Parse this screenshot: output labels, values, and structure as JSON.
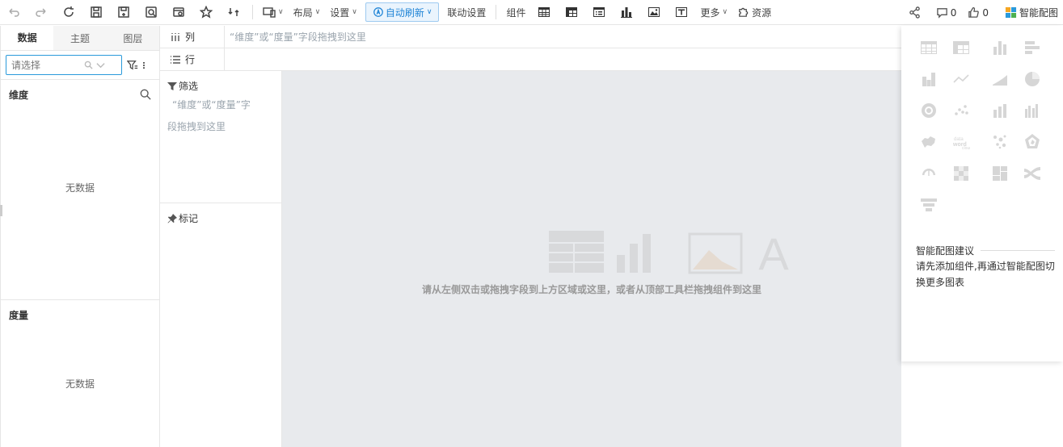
{
  "toolbar": {
    "layout_label": "布局",
    "settings_label": "设置",
    "auto_refresh_label": "自动刷新",
    "linkage_label": "联动设置",
    "component_label": "组件",
    "more_label": "更多",
    "resources_label": "资源"
  },
  "right_tools": {
    "comments_count": "0",
    "likes_count": "0",
    "smart_chart_label": "智能配图"
  },
  "left_panel": {
    "tabs": [
      {
        "label": "数据",
        "active": true
      },
      {
        "label": "主题",
        "active": false
      },
      {
        "label": "图层",
        "active": false
      }
    ],
    "search_placeholder": "请选择",
    "dimension_title": "维度",
    "dimension_empty": "无数据",
    "measure_title": "度量",
    "measure_empty": "无数据"
  },
  "rowcol": {
    "column_label": "列",
    "row_label": "行",
    "column_hint": "“维度”或“度量”字段拖拽到这里"
  },
  "middle_panel": {
    "filter_title": "筛选",
    "filter_hint_line1": "“维度”或“度量”字",
    "filter_hint_line2": "段拖拽到这里",
    "mark_title": "标记"
  },
  "canvas": {
    "hint": "请从左侧双击或拖拽字段到上方区域或这里，或者从顶部工具栏拖拽组件到这里"
  },
  "smart_panel": {
    "suggest_title": "智能配图建议",
    "suggest_text": "请先添加组件,再通过智能配图切换更多图表",
    "chart_types": [
      "table",
      "cross-table",
      "bar",
      "horizontal-bar",
      "stacked-bar",
      "line",
      "area",
      "pie",
      "ring",
      "scatter",
      "combo",
      "multi-bar",
      "map",
      "word-cloud",
      "dot-map",
      "radar",
      "gauge",
      "heatmap",
      "treemap",
      "sankey",
      "funnel"
    ]
  }
}
